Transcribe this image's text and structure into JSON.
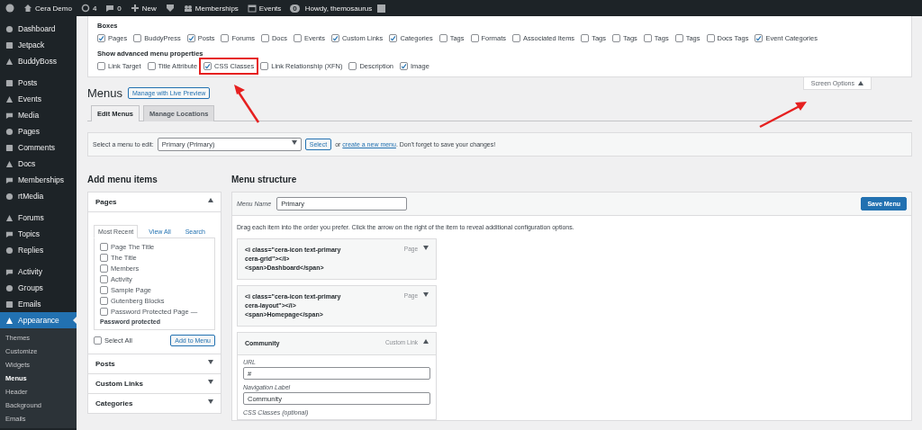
{
  "admin_bar": {
    "site": "Cera Demo",
    "updates": "4",
    "comments": "0",
    "new": "New",
    "items": [
      "Memberships",
      "Events"
    ],
    "notifications": "0",
    "greeting": "Howdy, themosaurus"
  },
  "sidebar": {
    "groups": [
      [
        {
          "label": "Dashboard",
          "selected": false
        },
        {
          "label": "Jetpack",
          "selected": false
        },
        {
          "label": "BuddyBoss",
          "selected": false
        }
      ],
      [
        {
          "label": "Posts",
          "selected": false
        },
        {
          "label": "Events",
          "selected": false
        },
        {
          "label": "Media",
          "selected": false
        },
        {
          "label": "Pages",
          "selected": false
        },
        {
          "label": "Comments",
          "selected": false
        },
        {
          "label": "Docs",
          "selected": false
        },
        {
          "label": "Memberships",
          "selected": false
        },
        {
          "label": "rtMedia",
          "selected": false
        }
      ],
      [
        {
          "label": "Forums",
          "selected": false
        },
        {
          "label": "Topics",
          "selected": false
        },
        {
          "label": "Replies",
          "selected": false
        }
      ],
      [
        {
          "label": "Activity",
          "selected": false
        },
        {
          "label": "Groups",
          "selected": false
        },
        {
          "label": "Emails",
          "selected": false
        },
        {
          "label": "Appearance",
          "selected": true
        }
      ]
    ],
    "submenu": [
      {
        "label": "Themes",
        "selected": false
      },
      {
        "label": "Customize",
        "selected": false
      },
      {
        "label": "Widgets",
        "selected": false
      },
      {
        "label": "Menus",
        "selected": true
      },
      {
        "label": "Header",
        "selected": false
      },
      {
        "label": "Background",
        "selected": false
      },
      {
        "label": "Emails",
        "selected": false
      }
    ]
  },
  "screen_options": {
    "boxes_title": "Boxes",
    "boxes": [
      {
        "label": "Pages",
        "checked": true
      },
      {
        "label": "BuddyPress",
        "checked": false
      },
      {
        "label": "Posts",
        "checked": true
      },
      {
        "label": "Forums",
        "checked": false
      },
      {
        "label": "Docs",
        "checked": false
      },
      {
        "label": "Events",
        "checked": false
      },
      {
        "label": "Custom Links",
        "checked": true
      },
      {
        "label": "Categories",
        "checked": true
      },
      {
        "label": "Tags",
        "checked": false
      },
      {
        "label": "Formats",
        "checked": false
      },
      {
        "label": "Associated Items",
        "checked": false
      },
      {
        "label": "Tags",
        "checked": false
      },
      {
        "label": "Tags",
        "checked": false
      },
      {
        "label": "Tags",
        "checked": false
      },
      {
        "label": "Tags",
        "checked": false
      },
      {
        "label": "Docs Tags",
        "checked": false
      },
      {
        "label": "Event Categories",
        "checked": true
      }
    ],
    "advanced_title": "Show advanced menu properties",
    "advanced": [
      {
        "label": "Link Target",
        "checked": false,
        "annotated": false
      },
      {
        "label": "Title Attribute",
        "checked": false,
        "annotated": false
      },
      {
        "label": "CSS Classes",
        "checked": true,
        "annotated": true
      },
      {
        "label": "Link Relationship (XFN)",
        "checked": false,
        "annotated": false
      },
      {
        "label": "Description",
        "checked": false,
        "annotated": false
      },
      {
        "label": "Image",
        "checked": true,
        "annotated": false
      }
    ],
    "tab": "Screen Options",
    "expanded": true
  },
  "page": {
    "title": "Menus",
    "preview_button": "Manage with Live Preview",
    "tabs": [
      {
        "label": "Edit Menus",
        "selected": true
      },
      {
        "label": "Manage Locations",
        "selected": false
      }
    ]
  },
  "select_bar": {
    "label": "Select a menu to edit:",
    "value": "Primary (Primary)",
    "button": "Select",
    "prefix": "or ",
    "link": "create a new menu",
    "suffix": ". Don't forget to save your changes!"
  },
  "add_items": {
    "title": "Add menu items",
    "panels": [
      {
        "title": "Pages",
        "expanded": true,
        "tabs": [
          {
            "label": "Most Recent",
            "selected": true
          },
          {
            "label": "View All",
            "selected": false
          },
          {
            "label": "Search",
            "selected": false
          }
        ],
        "items": [
          {
            "kind": "checkbox",
            "label": "Page The Title",
            "checked": false
          },
          {
            "kind": "checkbox",
            "label": "The Title",
            "checked": false
          },
          {
            "kind": "checkbox",
            "label": "Members",
            "checked": false
          },
          {
            "kind": "checkbox",
            "label": "Activity",
            "checked": false
          },
          {
            "kind": "checkbox",
            "label": "Sample Page",
            "checked": false
          },
          {
            "kind": "checkbox",
            "label": "Gutenberg Blocks",
            "checked": false
          },
          {
            "kind": "checkbox",
            "label": "Password Protected Page —",
            "checked": false
          },
          {
            "kind": "heading",
            "label": "Password protected"
          }
        ],
        "select_all": {
          "label": "Select All",
          "checked": false
        },
        "add_button": "Add to Menu"
      },
      {
        "title": "Posts",
        "expanded": false
      },
      {
        "title": "Custom Links",
        "expanded": false
      },
      {
        "title": "Categories",
        "expanded": false
      }
    ]
  },
  "menu_structure": {
    "title": "Menu structure",
    "name_label": "Menu Name",
    "name_value": "Primary",
    "save_button": "Save Menu",
    "instructions": "Drag each item into the order you prefer. Click the arrow on the right of the item to reveal additional configuration options.",
    "items": [
      {
        "title_lines": [
          "<i class=\"cera-icon text-primary",
          "cera-grid\"></i>",
          "<span>Dashboard</span>"
        ],
        "type": "Page",
        "expanded": false
      },
      {
        "title_lines": [
          "<i class=\"cera-icon text-primary",
          "cera-layout\"></i>",
          "<span>Homepage</span>"
        ],
        "type": "Page",
        "expanded": false
      },
      {
        "title_lines": [
          "Community"
        ],
        "type": "Custom Link",
        "expanded": true,
        "fields": [
          {
            "label": "URL",
            "value": "#"
          },
          {
            "label": "Navigation Label",
            "value": "Community"
          },
          {
            "label": "CSS Classes (optional)"
          }
        ]
      }
    ]
  }
}
